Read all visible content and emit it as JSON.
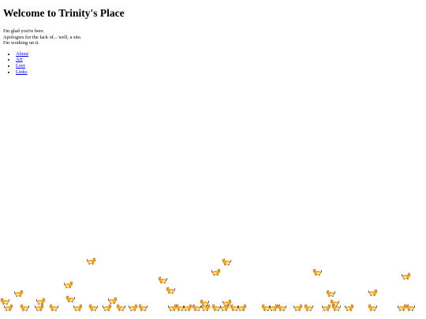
{
  "page": {
    "title": "Welcome to Trinity's Place",
    "intro_lines": [
      "I'm glad you're here.",
      "Apologies for the lack of... well, a site.",
      "I'm working on it."
    ]
  },
  "nav": {
    "links": [
      "About",
      "Art",
      "Lore",
      "Links"
    ]
  },
  "decoration": {
    "critter_icon": "cat-critter-icon",
    "colors": {
      "link": "#0000ee",
      "critter_body": "#f5a623",
      "critter_dark": "#3a2a1a",
      "critter_light": "#fde9b8"
    }
  }
}
